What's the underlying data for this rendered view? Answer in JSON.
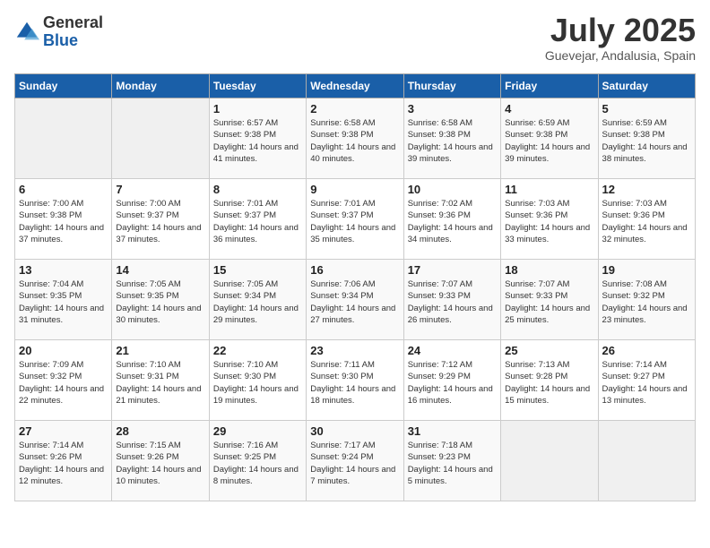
{
  "header": {
    "logo_general": "General",
    "logo_blue": "Blue",
    "month": "July 2025",
    "location": "Guevejar, Andalusia, Spain"
  },
  "calendar": {
    "days_of_week": [
      "Sunday",
      "Monday",
      "Tuesday",
      "Wednesday",
      "Thursday",
      "Friday",
      "Saturday"
    ],
    "weeks": [
      [
        {
          "day": "",
          "detail": ""
        },
        {
          "day": "",
          "detail": ""
        },
        {
          "day": "1",
          "detail": "Sunrise: 6:57 AM\nSunset: 9:38 PM\nDaylight: 14 hours and 41 minutes."
        },
        {
          "day": "2",
          "detail": "Sunrise: 6:58 AM\nSunset: 9:38 PM\nDaylight: 14 hours and 40 minutes."
        },
        {
          "day": "3",
          "detail": "Sunrise: 6:58 AM\nSunset: 9:38 PM\nDaylight: 14 hours and 39 minutes."
        },
        {
          "day": "4",
          "detail": "Sunrise: 6:59 AM\nSunset: 9:38 PM\nDaylight: 14 hours and 39 minutes."
        },
        {
          "day": "5",
          "detail": "Sunrise: 6:59 AM\nSunset: 9:38 PM\nDaylight: 14 hours and 38 minutes."
        }
      ],
      [
        {
          "day": "6",
          "detail": "Sunrise: 7:00 AM\nSunset: 9:38 PM\nDaylight: 14 hours and 37 minutes."
        },
        {
          "day": "7",
          "detail": "Sunrise: 7:00 AM\nSunset: 9:37 PM\nDaylight: 14 hours and 37 minutes."
        },
        {
          "day": "8",
          "detail": "Sunrise: 7:01 AM\nSunset: 9:37 PM\nDaylight: 14 hours and 36 minutes."
        },
        {
          "day": "9",
          "detail": "Sunrise: 7:01 AM\nSunset: 9:37 PM\nDaylight: 14 hours and 35 minutes."
        },
        {
          "day": "10",
          "detail": "Sunrise: 7:02 AM\nSunset: 9:36 PM\nDaylight: 14 hours and 34 minutes."
        },
        {
          "day": "11",
          "detail": "Sunrise: 7:03 AM\nSunset: 9:36 PM\nDaylight: 14 hours and 33 minutes."
        },
        {
          "day": "12",
          "detail": "Sunrise: 7:03 AM\nSunset: 9:36 PM\nDaylight: 14 hours and 32 minutes."
        }
      ],
      [
        {
          "day": "13",
          "detail": "Sunrise: 7:04 AM\nSunset: 9:35 PM\nDaylight: 14 hours and 31 minutes."
        },
        {
          "day": "14",
          "detail": "Sunrise: 7:05 AM\nSunset: 9:35 PM\nDaylight: 14 hours and 30 minutes."
        },
        {
          "day": "15",
          "detail": "Sunrise: 7:05 AM\nSunset: 9:34 PM\nDaylight: 14 hours and 29 minutes."
        },
        {
          "day": "16",
          "detail": "Sunrise: 7:06 AM\nSunset: 9:34 PM\nDaylight: 14 hours and 27 minutes."
        },
        {
          "day": "17",
          "detail": "Sunrise: 7:07 AM\nSunset: 9:33 PM\nDaylight: 14 hours and 26 minutes."
        },
        {
          "day": "18",
          "detail": "Sunrise: 7:07 AM\nSunset: 9:33 PM\nDaylight: 14 hours and 25 minutes."
        },
        {
          "day": "19",
          "detail": "Sunrise: 7:08 AM\nSunset: 9:32 PM\nDaylight: 14 hours and 23 minutes."
        }
      ],
      [
        {
          "day": "20",
          "detail": "Sunrise: 7:09 AM\nSunset: 9:32 PM\nDaylight: 14 hours and 22 minutes."
        },
        {
          "day": "21",
          "detail": "Sunrise: 7:10 AM\nSunset: 9:31 PM\nDaylight: 14 hours and 21 minutes."
        },
        {
          "day": "22",
          "detail": "Sunrise: 7:10 AM\nSunset: 9:30 PM\nDaylight: 14 hours and 19 minutes."
        },
        {
          "day": "23",
          "detail": "Sunrise: 7:11 AM\nSunset: 9:30 PM\nDaylight: 14 hours and 18 minutes."
        },
        {
          "day": "24",
          "detail": "Sunrise: 7:12 AM\nSunset: 9:29 PM\nDaylight: 14 hours and 16 minutes."
        },
        {
          "day": "25",
          "detail": "Sunrise: 7:13 AM\nSunset: 9:28 PM\nDaylight: 14 hours and 15 minutes."
        },
        {
          "day": "26",
          "detail": "Sunrise: 7:14 AM\nSunset: 9:27 PM\nDaylight: 14 hours and 13 minutes."
        }
      ],
      [
        {
          "day": "27",
          "detail": "Sunrise: 7:14 AM\nSunset: 9:26 PM\nDaylight: 14 hours and 12 minutes."
        },
        {
          "day": "28",
          "detail": "Sunrise: 7:15 AM\nSunset: 9:26 PM\nDaylight: 14 hours and 10 minutes."
        },
        {
          "day": "29",
          "detail": "Sunrise: 7:16 AM\nSunset: 9:25 PM\nDaylight: 14 hours and 8 minutes."
        },
        {
          "day": "30",
          "detail": "Sunrise: 7:17 AM\nSunset: 9:24 PM\nDaylight: 14 hours and 7 minutes."
        },
        {
          "day": "31",
          "detail": "Sunrise: 7:18 AM\nSunset: 9:23 PM\nDaylight: 14 hours and 5 minutes."
        },
        {
          "day": "",
          "detail": ""
        },
        {
          "day": "",
          "detail": ""
        }
      ]
    ]
  }
}
